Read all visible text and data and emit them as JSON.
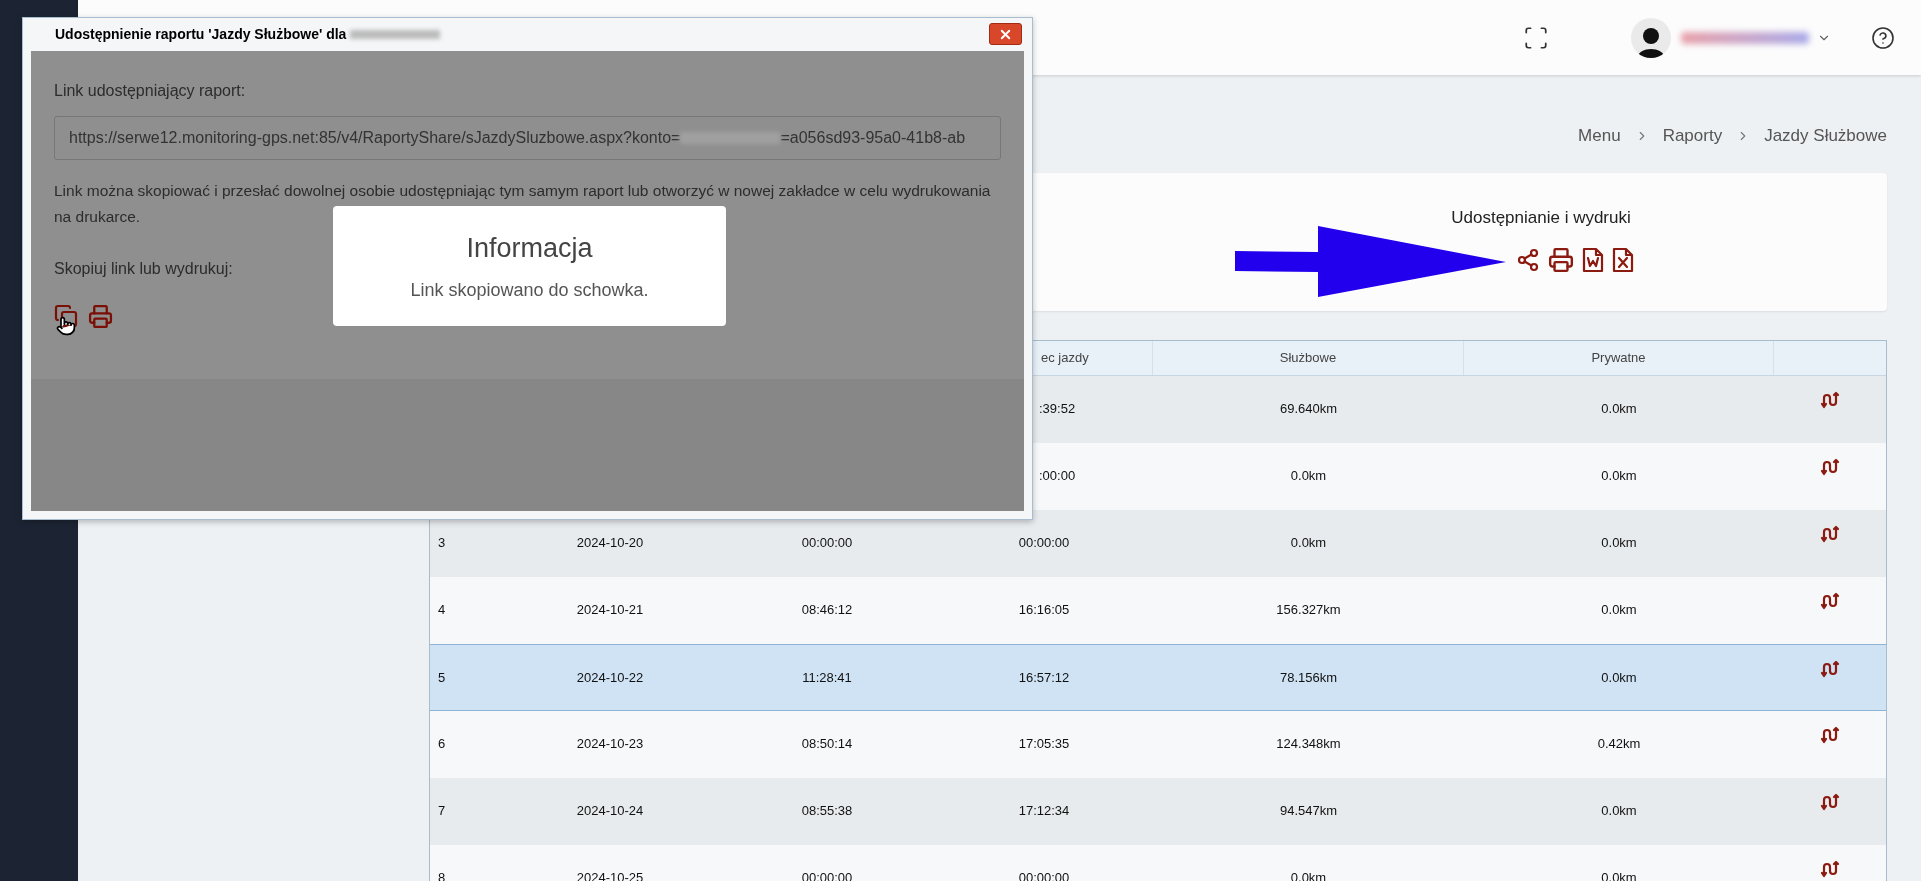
{
  "dialog": {
    "title": "Udostępnienie raportu 'Jazdy Służbowe' dla",
    "link_label": "Link udostępniający raport:",
    "link_url_start": "https://serwe12.monitoring-gps.net:85/v4/RaportyShare/sJazdySluzbowe.aspx?konto=",
    "link_url_end": "=a056sd93-95a0-41b8-ab",
    "description": "Link można skopiować i przesłać dowolnej osobie udostępniając tym samym raport lub otworzyć w nowej zakładce w celu wydrukowania na drukarce.",
    "actions_label": "Skopiuj link lub wydrukuj:"
  },
  "toast": {
    "title": "Informacja",
    "message": "Link skopiowano do schowka."
  },
  "breadcrumb": [
    "Menu",
    "Raporty",
    "Jazdy Służbowe"
  ],
  "share_card": {
    "title": "Udostępnianie i wydruki"
  },
  "table": {
    "columns": [
      "ec jazdy",
      "Służbowe",
      "Prywatne"
    ],
    "rows": [
      {
        "end": ":39:52",
        "business": "69.640km",
        "private": "0.0km",
        "selected": false
      },
      {
        "end": ":00:00",
        "business": "0.0km",
        "private": "0.0km",
        "selected": false
      },
      {
        "number": "3",
        "date": "2024-10-20",
        "start": "00:00:00",
        "end": "00:00:00",
        "business": "0.0km",
        "private": "0.0km",
        "selected": false
      },
      {
        "number": "4",
        "date": "2024-10-21",
        "start": "08:46:12",
        "end": "16:16:05",
        "business": "156.327km",
        "private": "0.0km",
        "selected": false
      },
      {
        "number": "5",
        "date": "2024-10-22",
        "start": "11:28:41",
        "end": "16:57:12",
        "business": "78.156km",
        "private": "0.0km",
        "selected": true
      },
      {
        "number": "6",
        "date": "2024-10-23",
        "start": "08:50:14",
        "end": "17:05:35",
        "business": "124.348km",
        "private": "0.42km",
        "selected": false
      },
      {
        "number": "7",
        "date": "2024-10-24",
        "start": "08:55:38",
        "end": "17:12:34",
        "business": "94.547km",
        "private": "0.0km",
        "selected": false
      },
      {
        "number": "8",
        "date": "2024-10-25",
        "start": "00:00:00",
        "end": "00:00:00",
        "business": "0.0km",
        "private": "0.0km",
        "selected": false
      }
    ]
  }
}
